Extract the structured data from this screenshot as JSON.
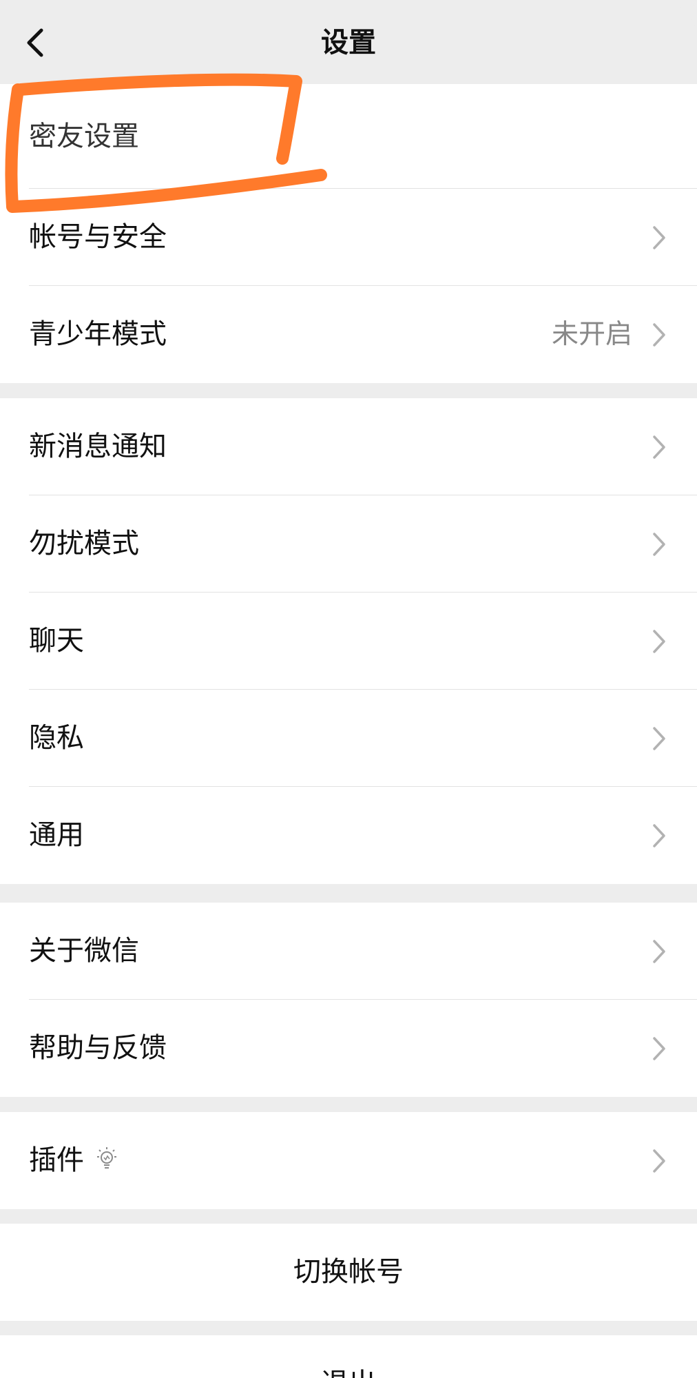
{
  "nav": {
    "title": "设置",
    "back_icon": "chevron-left-icon"
  },
  "group1": [
    {
      "label": "密友设置",
      "value": "",
      "chevron": false
    },
    {
      "label": "帐号与安全",
      "value": "",
      "chevron": true
    },
    {
      "label": "青少年模式",
      "value": "未开启",
      "chevron": true
    }
  ],
  "group2": [
    {
      "label": "新消息通知"
    },
    {
      "label": "勿扰模式"
    },
    {
      "label": "聊天"
    },
    {
      "label": "隐私"
    },
    {
      "label": "通用"
    }
  ],
  "group3": [
    {
      "label": "关于微信"
    },
    {
      "label": "帮助与反馈"
    }
  ],
  "group4": [
    {
      "label": "插件",
      "icon": "lightbulb-icon"
    }
  ],
  "switch_account": {
    "label": "切换帐号"
  },
  "logout": {
    "label": "退出"
  },
  "annotation": {
    "color": "#ff7a2b"
  },
  "colors": {
    "background": "#ededed",
    "card": "#ffffff",
    "text": "#111111",
    "secondary_text": "#888888",
    "chevron": "#b2b2b2"
  }
}
